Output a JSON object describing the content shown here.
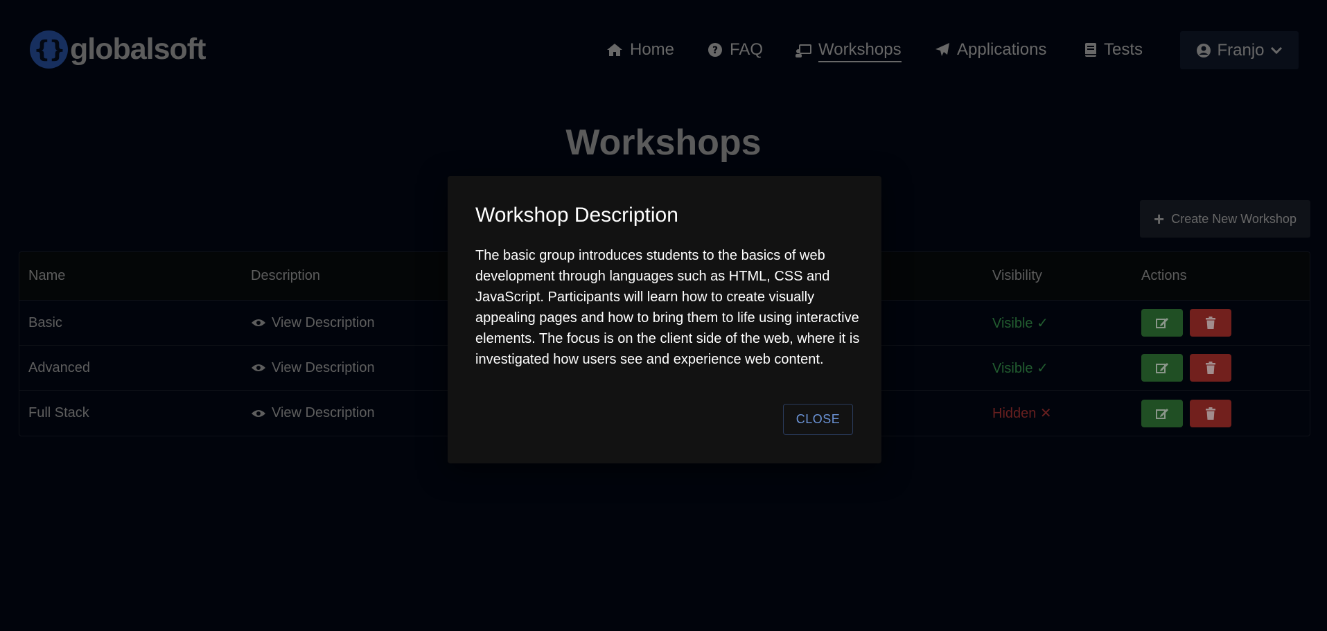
{
  "brand": {
    "name": "globalsoft",
    "logo_glyph": "{}"
  },
  "nav": {
    "items": [
      {
        "label": "Home",
        "icon": "home-icon"
      },
      {
        "label": "FAQ",
        "icon": "question-circle-icon"
      },
      {
        "label": "Workshops",
        "icon": "chalkboard-teacher-icon",
        "active": true
      },
      {
        "label": "Applications",
        "icon": "paper-plane-icon"
      },
      {
        "label": "Tests",
        "icon": "book-icon"
      }
    ],
    "user": {
      "name": "Franjo",
      "icon": "user-circle-icon"
    }
  },
  "page": {
    "title": "Workshops",
    "create_label": "Create New Workshop"
  },
  "table": {
    "headers": {
      "name": "Name",
      "description": "Description",
      "visibility": "Visibility",
      "actions": "Actions"
    },
    "rows": [
      {
        "name": "Basic",
        "description_link": "View Description",
        "visibility": "Visible ✓",
        "visible": true
      },
      {
        "name": "Advanced",
        "description_link": "View Description",
        "visibility": "Visible ✓",
        "visible": true
      },
      {
        "name": "Full Stack",
        "description_link": "View Description",
        "visibility": "Hidden ✕",
        "visible": false
      }
    ]
  },
  "modal": {
    "title": "Workshop Description",
    "body": "The basic group introduces students to the basics of web development through languages such as HTML, CSS and JavaScript. Participants will learn how to create visually appealing pages and how to bring them to life using interactive elements. The focus is on the client side of the web, where it is investigated how users see and experience web content.",
    "close_label": "CLOSE"
  },
  "colors": {
    "background": "#020610",
    "visible": "#2e7d40",
    "hidden": "#8a2a2a",
    "edit_button": "#2b6a30",
    "delete_button": "#992b27",
    "accent_link": "#6b93d6",
    "logo": "#1f3f7e"
  }
}
